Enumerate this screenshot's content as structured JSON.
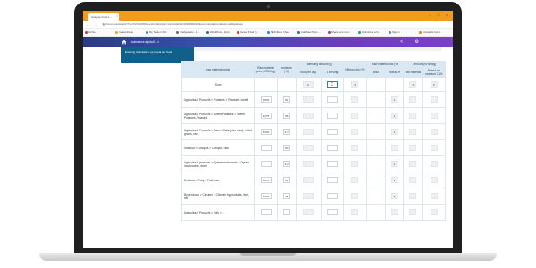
{
  "browser": {
    "tab_title": "Analyse Food L...",
    "tab_close": "×",
    "window_controls": "– □ ×",
    "nav": "← → ↻",
    "url": "nutrisurvey.net/calculator/?time=51710440384&version=1&program=nutrition&id=1ECFF8B0066F8A4&name=calculateFood&code=calcBaseRecipe",
    "bookmarks": [
      {
        "label": "Ad Se...",
        "color": "#d33"
      },
      {
        "label": "f.calendrique",
        "color": "#e8a33a"
      },
      {
        "label": "My Tasks in Wr...",
        "color": "#3b7bd4"
      },
      {
        "label": "Analyseparo - D...",
        "color": "#6a6a6a"
      },
      {
        "label": "WordPress - Envi...",
        "color": "#21759b"
      },
      {
        "label": "Gewer Final Ty...",
        "color": "#c0392b"
      },
      {
        "label": "SEO Book Chai...",
        "color": "#2e86de"
      },
      {
        "label": "Add New Post ‹...",
        "color": "#21759b"
      },
      {
        "label": "Share your recu...",
        "color": "#8e44ad"
      },
      {
        "label": "Optimising a N...",
        "color": "#16a085"
      },
      {
        "label": "Sign in",
        "color": "#4285f4"
      },
      {
        "label": "Answer & Cont...",
        "color": "#e67e22"
      }
    ]
  },
  "app": {
    "breadcrumb": "substance.agricult... ▾",
    "header_icons": "< ⚙",
    "side_card": "Entering Calculation: per meal per food"
  },
  "table": {
    "headers": {
      "raw_material_name": "raw material name",
      "raw_material_price": "Raw material price (KRW/kg)",
      "moisture": "moisture (%)",
      "blending_amount": "Blending amount (g)",
      "food_per_day": "food per day",
      "one_serving": "1 serving",
      "mixing_ratio": "Mixing ratio (%)",
      "raw_material_lost": "Raw material lost (%)",
      "lead": "lead",
      "moisture_sm": "moistu re",
      "amount": "Amount (KRW/kg)",
      "raw_material": "raw material",
      "based_on_moisture": "Based on moisture 12%"
    },
    "sum_row": {
      "label": "Sum",
      "food_per_day": "0",
      "mixing_ratio": "0",
      "amount_raw": "0",
      "amount_based": "0"
    },
    "rows": [
      {
        "name": "Agricultural Products > Potatoes > Potatoes, boiled",
        "price": "1,800",
        "moisture": "81",
        "lost": "1"
      },
      {
        "name": "Agricultural Products > Sweet Potatoes > Sweet Potatoes, Roasted",
        "price": "2,275",
        "moisture": "58",
        "lost": "1"
      },
      {
        "name": "Agricultural Products > Oats > Oats, (rice oats), milled grains, raw",
        "price": "5,000",
        "moisture": "9.7",
        "lost": "1"
      },
      {
        "name": "Seafood > Octopus > Octopus, raw",
        "price": "",
        "moisture": "80",
        "lost": ""
      },
      {
        "name": "Agricultural products > Oyster mushrooms > Oyster mushrooms, dried",
        "price": "",
        "moisture": "9.2",
        "lost": "1"
      },
      {
        "name": "Seafood > Foky > Fold, raw",
        "price": "6,270",
        "moisture": "81",
        "lost": "3"
      },
      {
        "name": "By products > Chicken > Chicken by products, liver, raw",
        "price": "2,000",
        "moisture": "75",
        "lost": "3"
      },
      {
        "name": "Agricultural Products > Tofu > ...",
        "price": "",
        "moisture": "",
        "lost": ""
      }
    ]
  }
}
